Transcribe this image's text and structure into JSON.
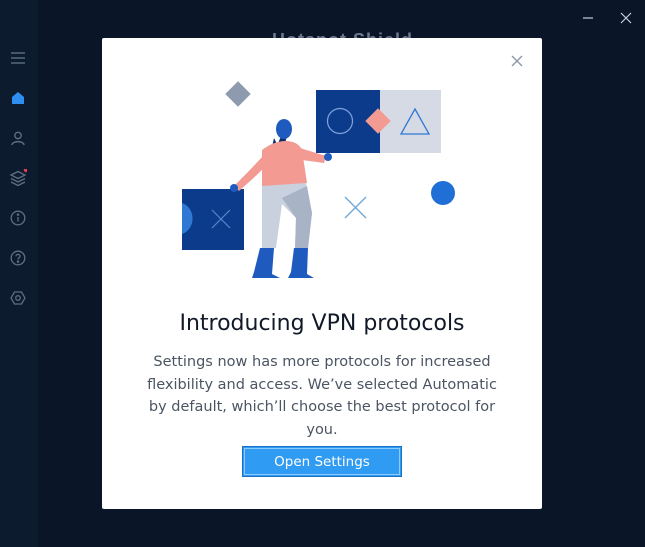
{
  "app": {
    "title": "Hotspot Shield",
    "minimize_icon": "minimize-icon",
    "close_icon": "close-icon"
  },
  "sidebar": {
    "items": [
      {
        "name": "menu",
        "icon": "hamburger-icon"
      },
      {
        "name": "home",
        "icon": "home-icon",
        "active": true
      },
      {
        "name": "account",
        "icon": "user-icon"
      },
      {
        "name": "products",
        "icon": "layers-icon",
        "badge": true
      },
      {
        "name": "about",
        "icon": "info-icon"
      },
      {
        "name": "help",
        "icon": "help-icon"
      },
      {
        "name": "settings",
        "icon": "gear-icon"
      }
    ]
  },
  "modal": {
    "title": "Introducing VPN protocols",
    "body": "Settings now has more protocols for increased flexibility and access. We’ve selected Automatic by default, which’ll choose the best protocol for you.",
    "button_label": "Open Settings",
    "close_icon": "close-icon"
  },
  "colors": {
    "navy": "#0d3b8c",
    "coral": "#f39a92",
    "accent_blue": "#2f9bf2",
    "dot_blue": "#1f6fd6",
    "grey_shape": "#8e9aae",
    "light_panel": "#d6dae4"
  }
}
